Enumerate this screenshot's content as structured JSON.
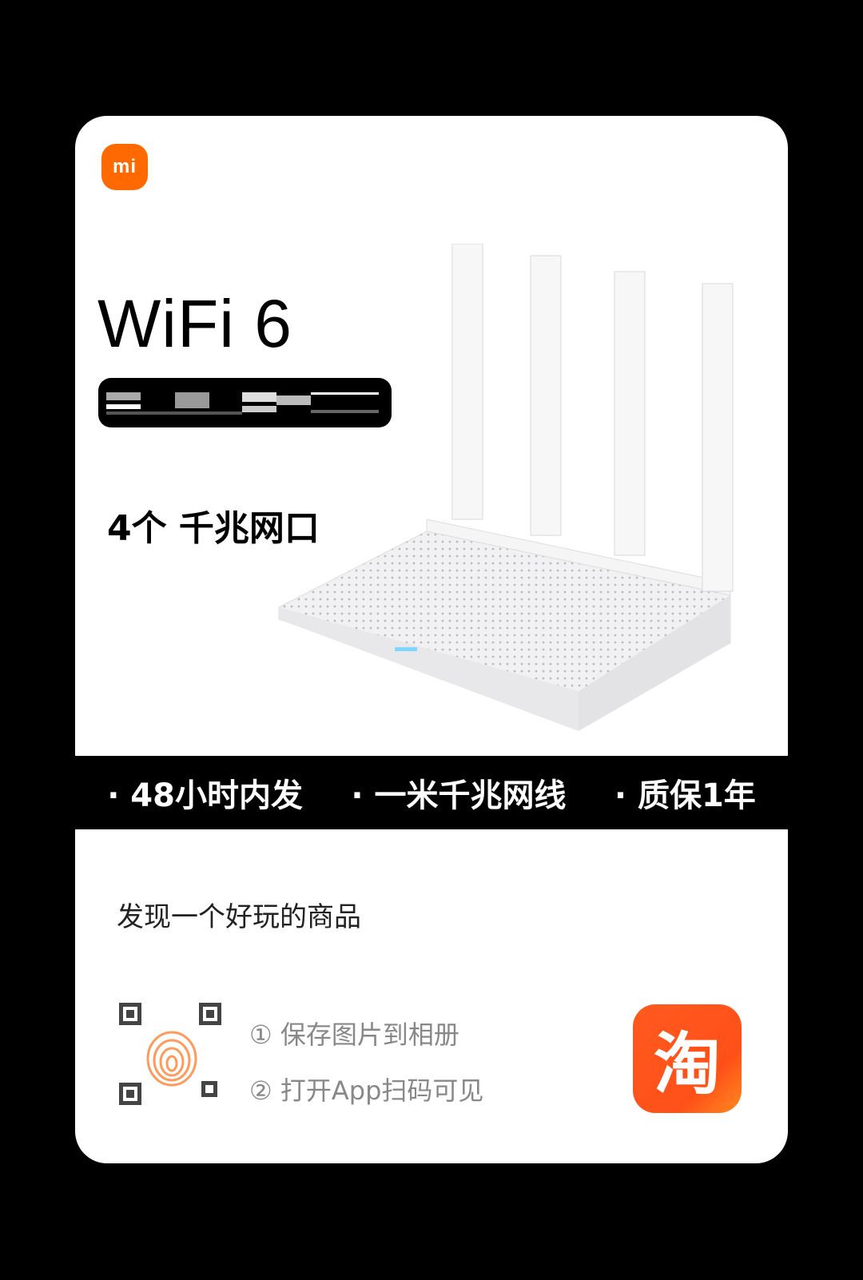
{
  "brand": {
    "logo_text": "mi",
    "color": "#ff6900"
  },
  "product": {
    "title": "WiFi 6",
    "ports": "4个 千兆网口"
  },
  "features": [
    "· 48小时内发",
    "· 一米千兆网线",
    "· 质保1年"
  ],
  "share": {
    "headline": "发现一个好玩的商品",
    "steps": [
      "① 保存图片到相册",
      "② 打开App扫码可见"
    ],
    "app_icon_text": "淘",
    "app_color": "#ff5a1f"
  }
}
